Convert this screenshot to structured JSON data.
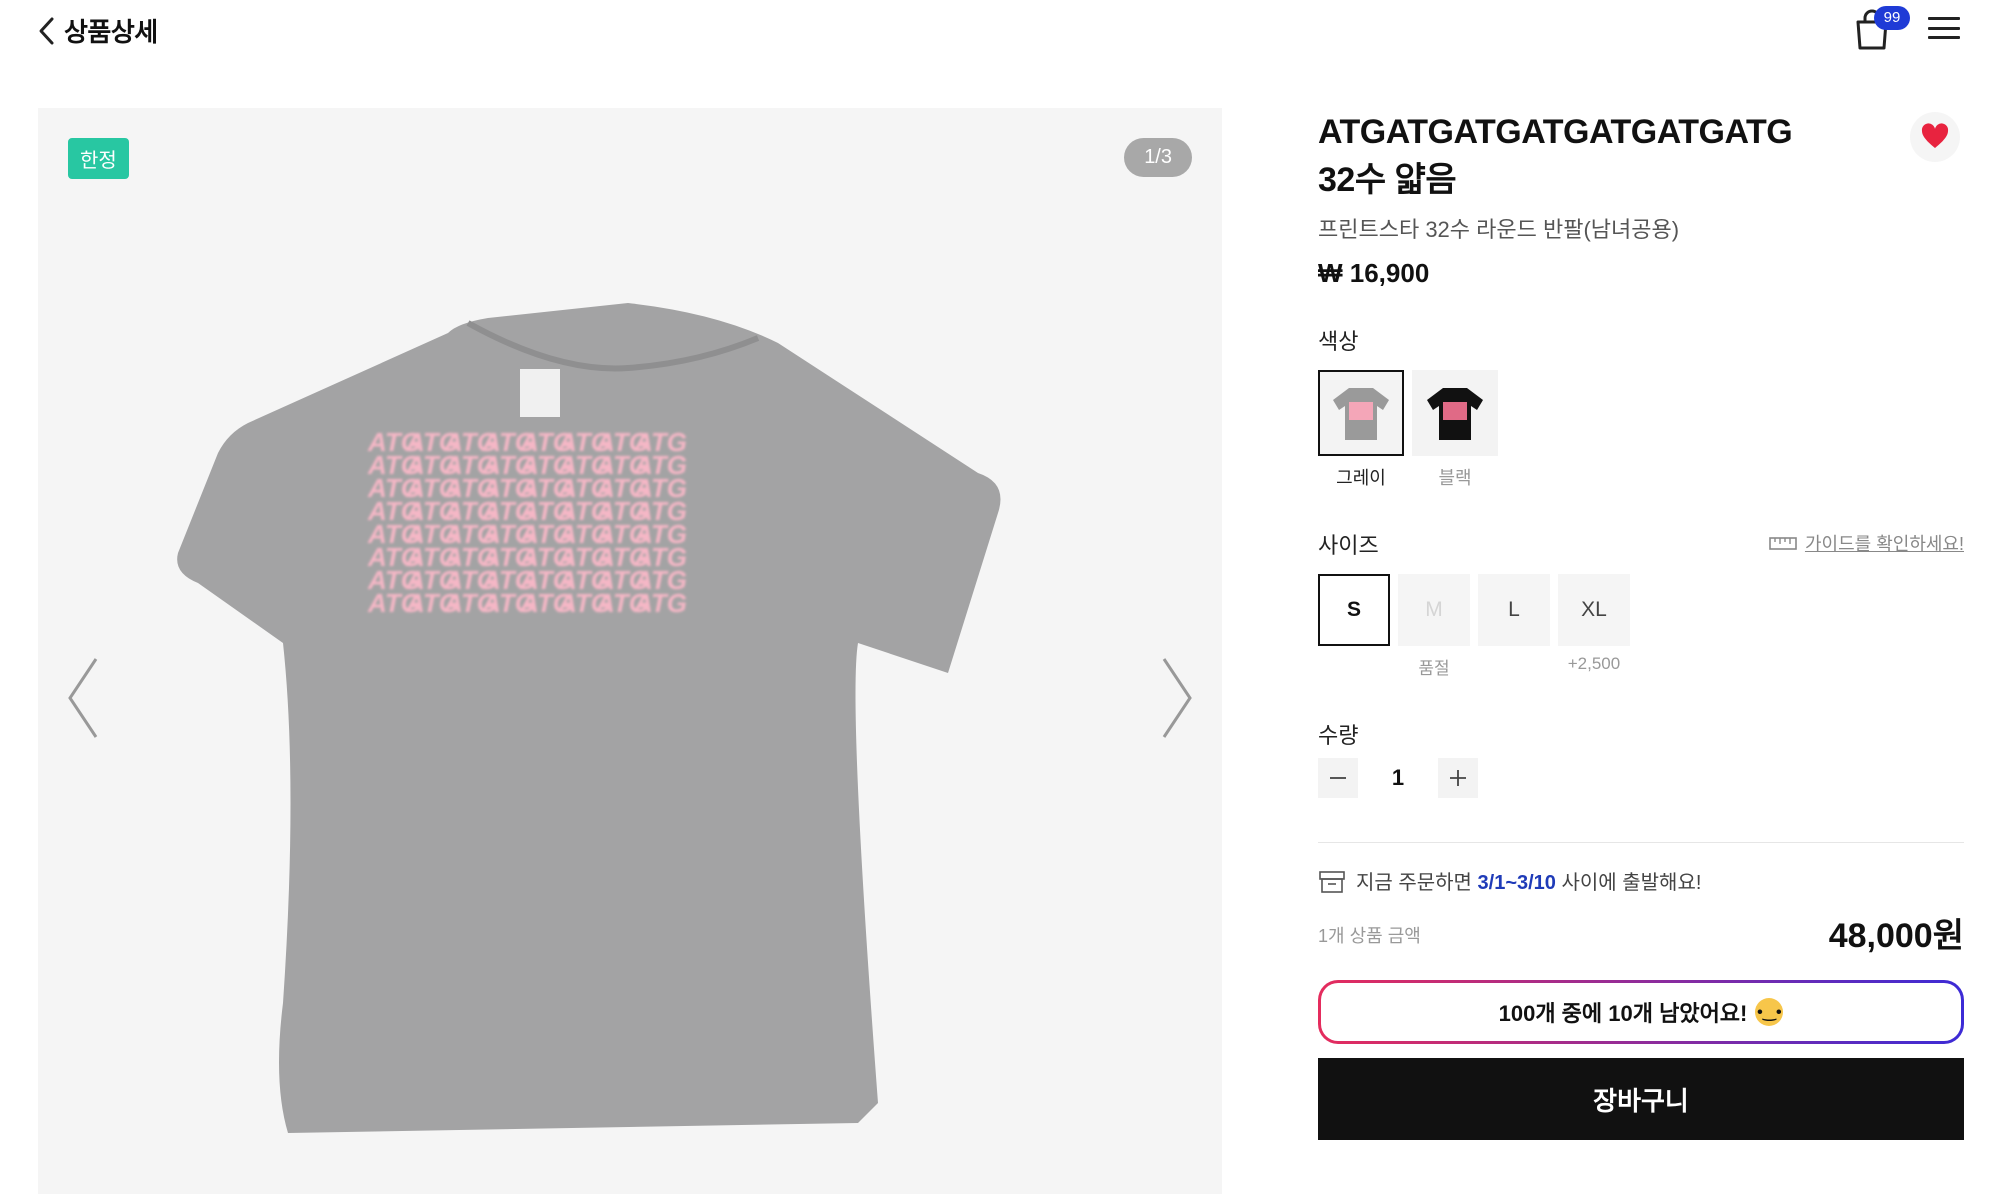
{
  "header": {
    "title": "상품상세",
    "cart_count": "99"
  },
  "gallery": {
    "tag": "한정",
    "counter": "1/3",
    "print_text": "ATG"
  },
  "product": {
    "title_line1": "ATGATGATGATGATGATGATG",
    "title_line2": "32수 얇음",
    "subtitle": "프린트스타 32수 라운드 반팔(남녀공용)",
    "price": "₩ 16,900"
  },
  "color": {
    "label": "색상",
    "options": [
      {
        "name": "그레이",
        "selected": true,
        "color": "#9a9a9a"
      },
      {
        "name": "블랙",
        "selected": false,
        "color": "#111111"
      }
    ]
  },
  "size": {
    "label": "사이즈",
    "guide": "가이드를 확인하세요!",
    "options": [
      {
        "name": "S",
        "note": ""
      },
      {
        "name": "M",
        "note": "품절"
      },
      {
        "name": "L",
        "note": ""
      },
      {
        "name": "XL",
        "note": "+2,500"
      }
    ]
  },
  "quantity": {
    "label": "수량",
    "value": "1"
  },
  "shipping": {
    "prefix": "지금 주문하면 ",
    "dates": "3/1~3/10",
    "suffix": " 사이에 출발해요!"
  },
  "summary": {
    "label": "1개 상품 금액",
    "total": "48,000원"
  },
  "stock": {
    "text": "100개 중에 10개 남았어요!"
  },
  "actions": {
    "cart": "장바구니"
  },
  "colors": {
    "accent": "#1f3bd6",
    "tag": "#28c7a2",
    "heart": "#e8233f",
    "print": "#f5b7c6"
  }
}
